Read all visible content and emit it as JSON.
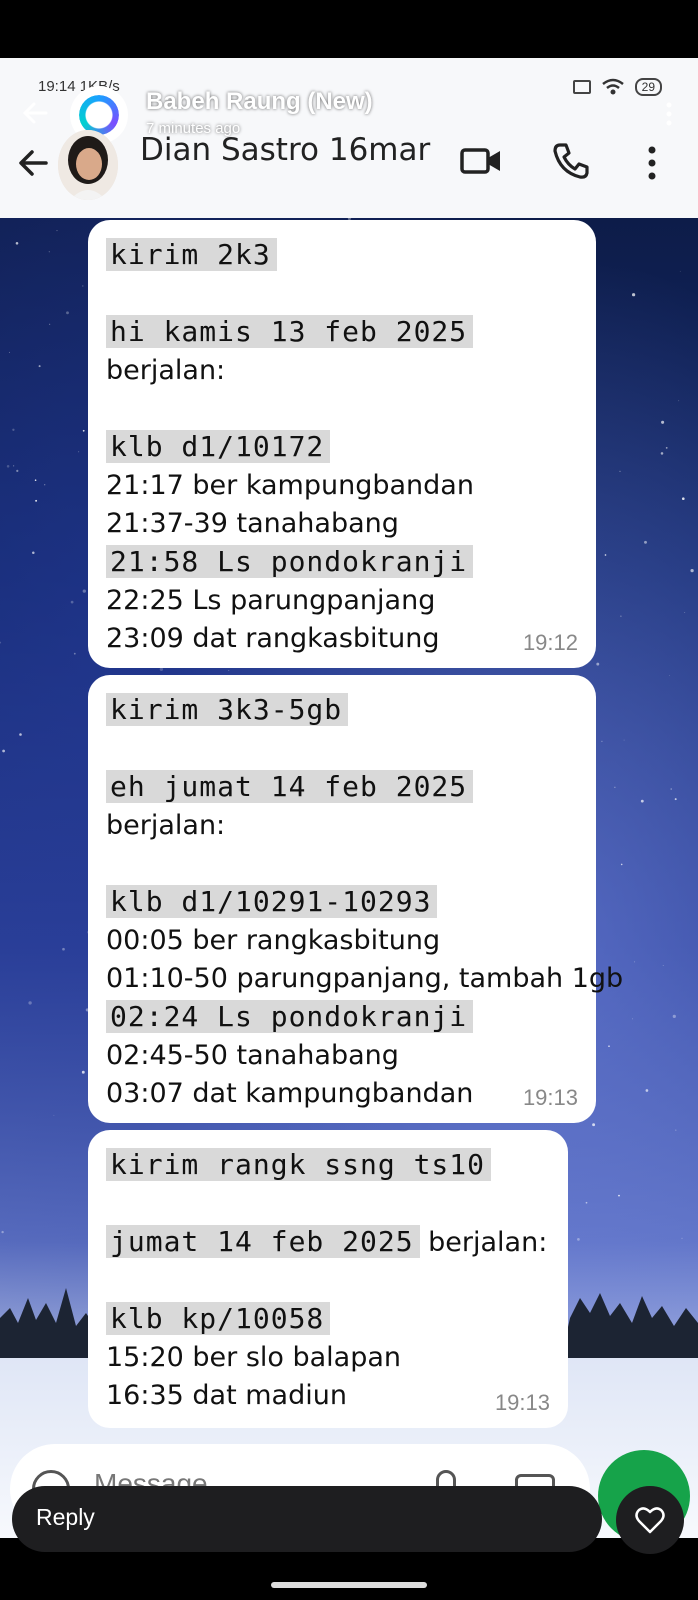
{
  "story": {
    "title": "Babeh Raung (New)",
    "time_ago": "7 minutes ago",
    "segments": 9
  },
  "status_bar": {
    "time": "19:14",
    "speed": "1KB/s",
    "battery": "29"
  },
  "chat": {
    "contact_name": "Dian Sastro 16mar"
  },
  "messages": [
    {
      "lines": [
        {
          "t": "kirim 2k3",
          "mono": true
        },
        {
          "t": ""
        },
        {
          "t": "hi kamis 13 feb 2025",
          "mono": true
        },
        {
          "t": "berjalan:"
        },
        {
          "t": ""
        },
        {
          "t": "klb d1/10172",
          "mono": true
        },
        {
          "t": "21:17 ber kampungbandan"
        },
        {
          "t": "21:37-39 tanahabang"
        },
        {
          "t": "21:58 Ls pondokranji",
          "mono": true
        },
        {
          "t": "22:25 Ls parungpanjang"
        },
        {
          "t": "23:09 dat rangkasbitung"
        }
      ],
      "time": "19:12"
    },
    {
      "lines": [
        {
          "t": "kirim 3k3-5gb",
          "mono": true
        },
        {
          "t": ""
        },
        {
          "t": "eh jumat 14 feb 2025",
          "mono": true
        },
        {
          "t": "berjalan:"
        },
        {
          "t": ""
        },
        {
          "t": "klb d1/10291-10293",
          "mono": true
        },
        {
          "t": "00:05 ber rangkasbitung"
        },
        {
          "t": "01:10-50 parungpanjang, tambah 1gb"
        },
        {
          "t": "02:24 Ls pondokranji",
          "mono": true
        },
        {
          "t": "02:45-50 tanahabang"
        },
        {
          "t": "03:07 dat kampungbandan"
        }
      ],
      "time": "19:13"
    },
    {
      "lines": [
        {
          "t": "kirim rangk ssng ts10",
          "mono": true
        },
        {
          "t": ""
        },
        {
          "t": "jumat 14 feb 2025",
          "mono": true,
          "tail": " berjalan:"
        },
        {
          "t": ""
        },
        {
          "t": "klb kp/10058",
          "mono": true
        },
        {
          "t": "15:20 ber slo balapan"
        },
        {
          "t": "16:35 dat madiun"
        }
      ],
      "time": "19:13"
    }
  ],
  "composer": {
    "placeholder": "Message"
  },
  "reply_bar": {
    "label": "Reply"
  },
  "colors": {
    "header_bg": "#f7f8fa",
    "bubble_bg": "#ffffff",
    "mono_highlight": "#d9d9d9",
    "send_green": "#16a34a"
  }
}
